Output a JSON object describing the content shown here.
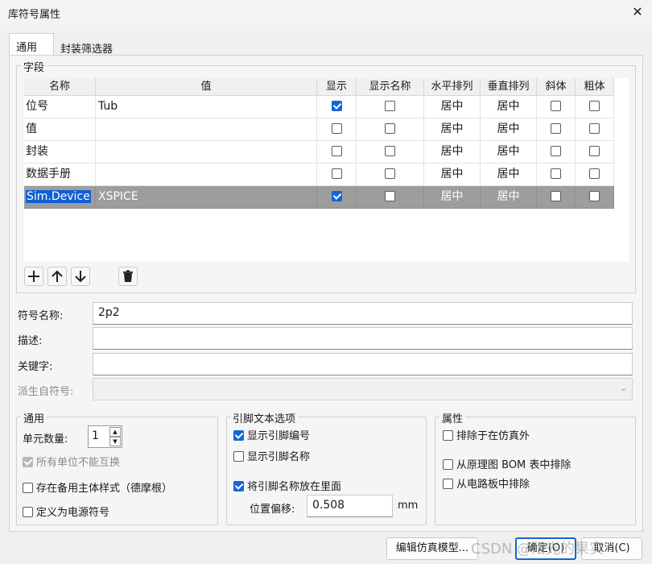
{
  "window": {
    "title": "库符号属性",
    "close_glyph": "✕"
  },
  "tabs": [
    {
      "label": "通用",
      "active": true
    },
    {
      "label": "封装筛选器",
      "active": false
    }
  ],
  "fields_group": {
    "title": "字段",
    "columns": [
      "名称",
      "值",
      "显示",
      "显示名称",
      "水平排列",
      "垂直排列",
      "斜体",
      "粗体"
    ],
    "rows": [
      {
        "name": "位号",
        "value": "Tub",
        "show": true,
        "show_name": false,
        "h_align": "居中",
        "v_align": "居中",
        "italic": false,
        "bold": false,
        "selected": false
      },
      {
        "name": "值",
        "value": "",
        "show": false,
        "show_name": false,
        "h_align": "居中",
        "v_align": "居中",
        "italic": false,
        "bold": false,
        "selected": false
      },
      {
        "name": "封装",
        "value": "",
        "show": false,
        "show_name": false,
        "h_align": "居中",
        "v_align": "居中",
        "italic": false,
        "bold": false,
        "selected": false
      },
      {
        "name": "数据手册",
        "value": "",
        "show": false,
        "show_name": false,
        "h_align": "居中",
        "v_align": "居中",
        "italic": false,
        "bold": false,
        "selected": false
      },
      {
        "name": "Sim.Device",
        "value": "XSPICE",
        "show": true,
        "show_name": false,
        "h_align": "居中",
        "v_align": "居中",
        "italic": false,
        "bold": false,
        "selected": true
      }
    ],
    "toolbar_icons": [
      "add-icon",
      "move-up-icon",
      "move-down-icon",
      "delete-icon"
    ]
  },
  "symbol_form": {
    "symbol_name_label": "符号名称:",
    "symbol_name_value": "2p2",
    "description_label": "描述:",
    "description_value": "",
    "keywords_label": "关键字:",
    "keywords_value": "",
    "derived_label": "派生自符号:",
    "derived_value": ""
  },
  "general_group": {
    "title": "通用",
    "unit_count_label": "单元数量:",
    "unit_count_value": "1",
    "units_not_interchangeable": {
      "label": "所有单位不能互换",
      "checked": true,
      "disabled": true
    },
    "alternate_body_style": {
      "label": "存在备用主体样式（德摩根）",
      "checked": false
    },
    "power_symbol": {
      "label": "定义为电源符号",
      "checked": false
    }
  },
  "pin_text_group": {
    "title": "引脚文本选项",
    "show_pin_number": {
      "label": "显示引脚编号",
      "checked": true
    },
    "show_pin_name": {
      "label": "显示引脚名称",
      "checked": false
    },
    "pin_name_inside": {
      "label": "将引脚名称放在里面",
      "checked": true
    },
    "position_offset_label": "位置偏移:",
    "position_offset_value": "0.508",
    "position_offset_unit": "mm"
  },
  "attributes_group": {
    "title": "属性",
    "exclude_sim": {
      "label": "排除于在仿真外",
      "checked": false
    },
    "exclude_bom": {
      "label": "从原理图 BOM 表中排除",
      "checked": false
    },
    "exclude_board": {
      "label": "从电路板中排除",
      "checked": false
    }
  },
  "footer": {
    "edit_sim_model_label": "编辑仿真模型...",
    "ok_label": "确定(O)",
    "cancel_label": "取消(C)",
    "watermark": "CSDN @阳光的果实"
  },
  "colors": {
    "accent": "#1464d8",
    "selected_row": "#9d9d9d",
    "selection_highlight": "#0f5fd6"
  }
}
